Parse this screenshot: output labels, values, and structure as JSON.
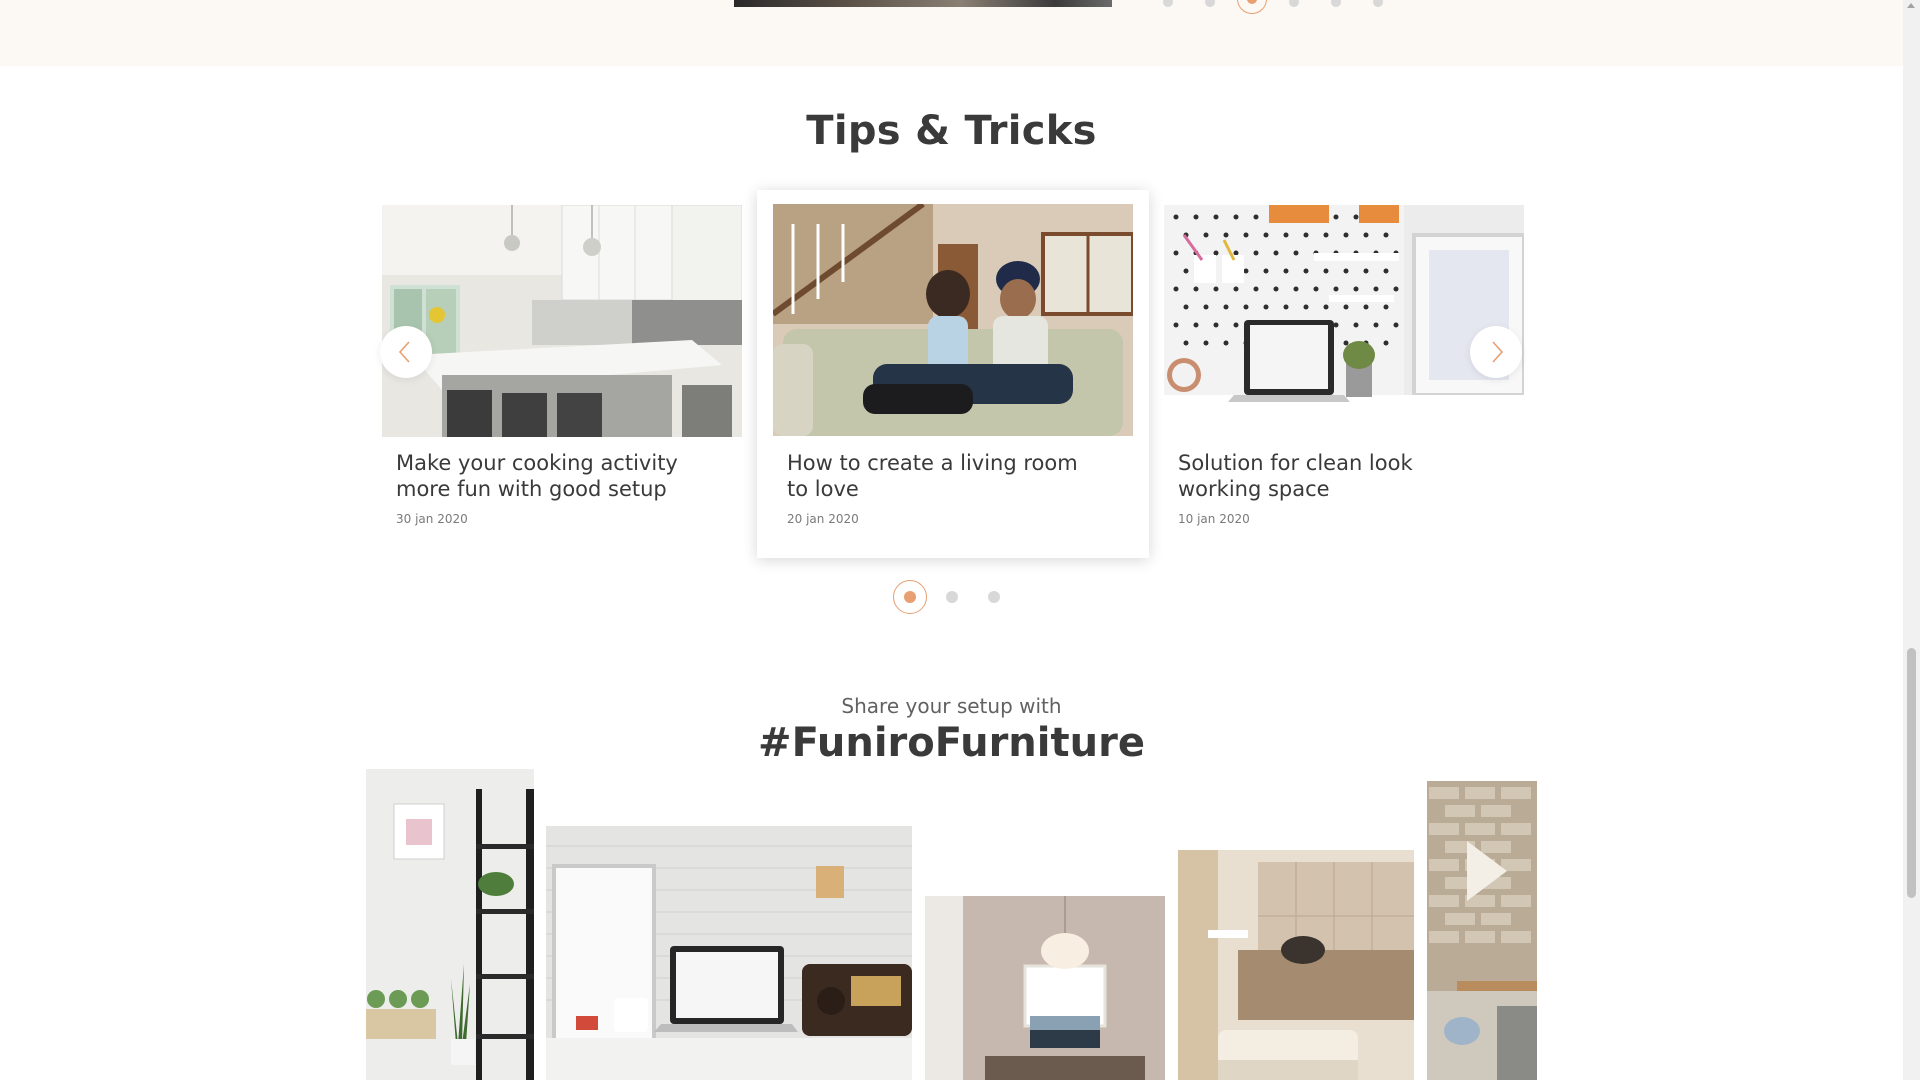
{
  "tips": {
    "title": "Tips & Tricks",
    "cards": [
      {
        "title": "Make your cooking activity more fun with good setup",
        "date": "30 jan 2020"
      },
      {
        "title": "How to create a living room to love",
        "date": "20 jan 2020"
      },
      {
        "title": "Solution for clean look working space",
        "date": "10 jan 2020"
      }
    ],
    "nav": {
      "prev_icon": "chevron-left-icon",
      "next_icon": "chevron-right-icon"
    },
    "pagination": {
      "count": 3,
      "active": 1
    }
  },
  "share": {
    "subtitle": "Share your setup with",
    "hashtag": "#FuniroFurniture"
  },
  "colors": {
    "accent": "#e89f71",
    "text_dark": "#3a3a3a",
    "text_muted": "#7a7a7a",
    "strip_bg": "#fcf8f3"
  }
}
